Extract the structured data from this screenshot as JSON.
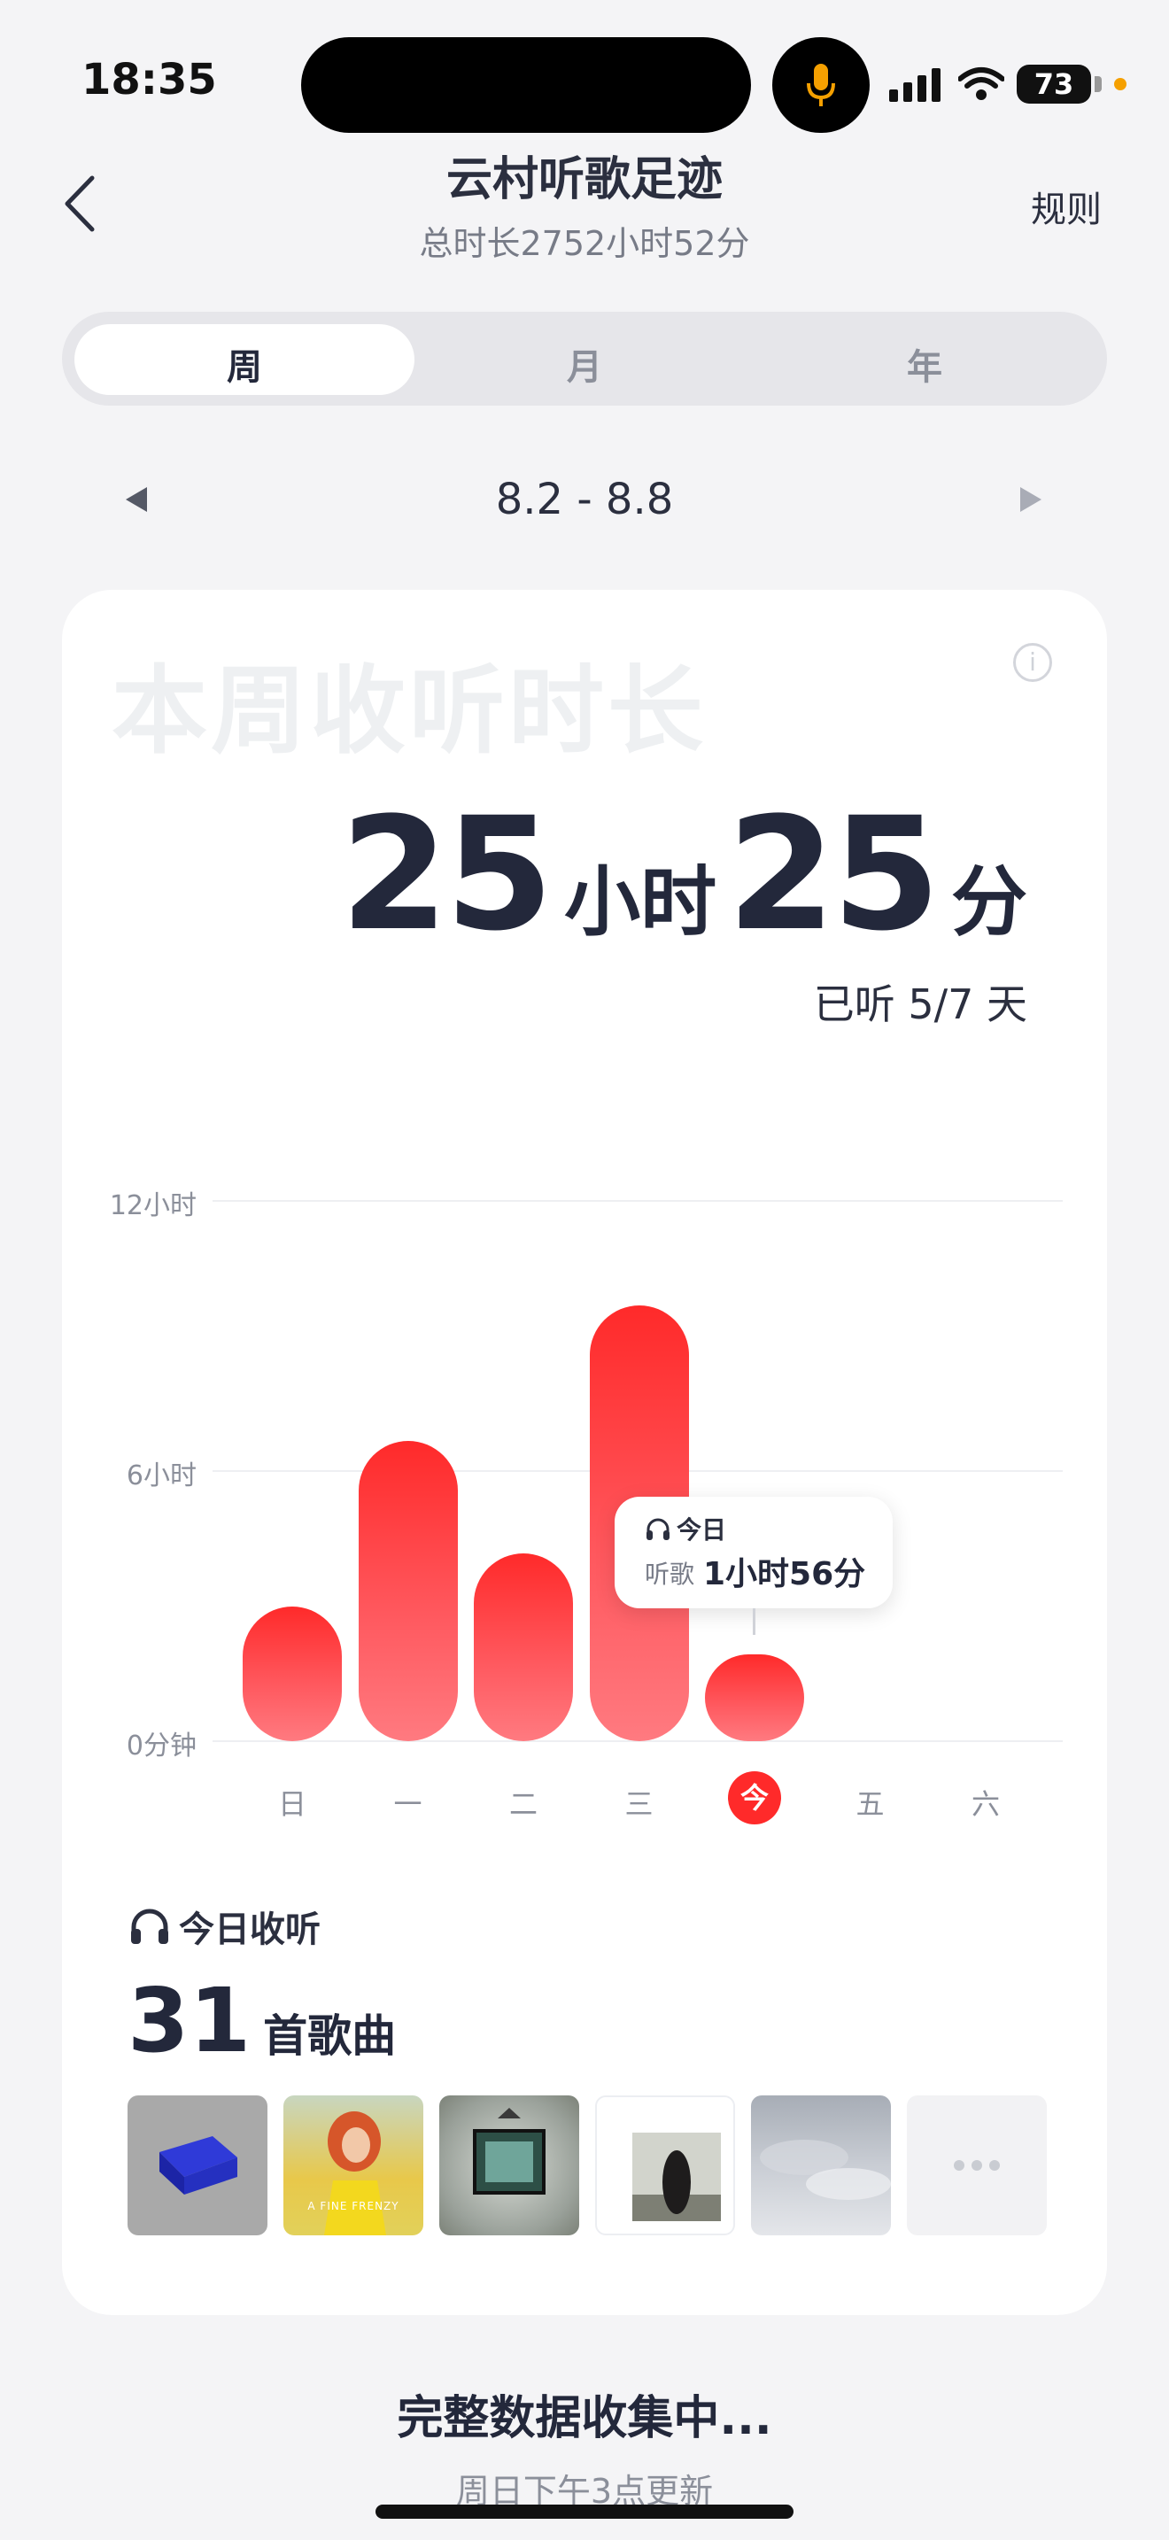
{
  "status_bar": {
    "time": "18:35",
    "battery": "73"
  },
  "header": {
    "title": "云村听歌足迹",
    "subtitle": "总时长2752小时52分",
    "rules_label": "规则"
  },
  "tabs": [
    {
      "label": "周",
      "active": true
    },
    {
      "label": "月"
    },
    {
      "label": "年"
    }
  ],
  "week": {
    "range": "8.2 - 8.8"
  },
  "card": {
    "watermark": "本周收听时长",
    "total_hours": "25",
    "hours_unit": "小时",
    "total_minutes": "25",
    "minutes_unit": "分",
    "listened_days": "已听 5/7 天"
  },
  "chart_data": {
    "type": "bar",
    "categories": [
      "日",
      "一",
      "二",
      "三",
      "今",
      "五",
      "六"
    ],
    "values": [
      3.0,
      6.67,
      4.17,
      9.67,
      1.93,
      0,
      0
    ],
    "ylim": [
      0,
      12
    ],
    "y_ticks": [
      {
        "value": 0,
        "label": "0分钟"
      },
      {
        "value": 6,
        "label": "6小时"
      },
      {
        "value": 12,
        "label": "12小时"
      }
    ],
    "grid": true,
    "highlight_index": 4
  },
  "tooltip": {
    "title": "今日",
    "label": "听歌",
    "value": "1小时56分"
  },
  "today_listen": {
    "title": "今日收听",
    "count": "31",
    "count_unit": "首歌曲"
  },
  "albums": [
    {
      "icon": "blue-blocks-cover"
    },
    {
      "icon": "a-fine-frenzy-cover",
      "text": "A FINE FRENZY"
    },
    {
      "icon": "framed-artwork-cover"
    },
    {
      "icon": "woman-in-field-cover"
    },
    {
      "icon": "cloudy-sky-cover"
    },
    {
      "icon": "more-icon"
    }
  ],
  "footer": {
    "title": "完整数据收集中...",
    "subtitle": "周日下午3点更新"
  }
}
